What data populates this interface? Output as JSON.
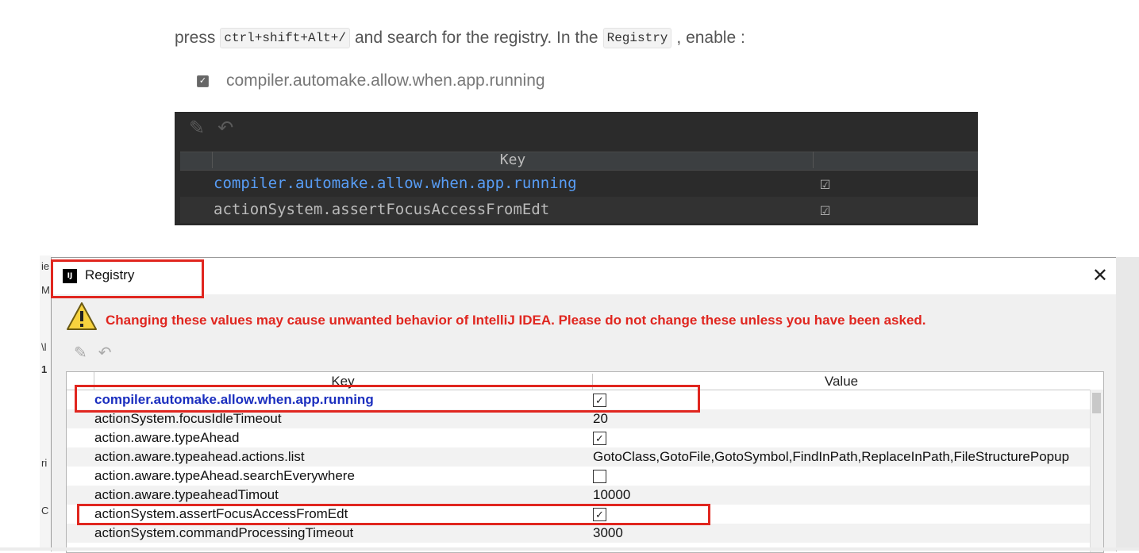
{
  "article": {
    "line1_pre": "press",
    "line1_code": "ctrl+shift+Alt+/",
    "line1_mid": "and search for the registry. In the",
    "line1_code2": "Registry",
    "line1_post": ", enable :",
    "checkbox_label": "compiler.automake.allow.when.app.running"
  },
  "dark_shot": {
    "header_key": "Key",
    "rows": [
      {
        "key": "compiler.automake.allow.when.app.running",
        "checked": true
      },
      {
        "key": "actionSystem.assertFocusAccessFromEdt",
        "checked": true
      }
    ]
  },
  "dialog": {
    "title": "Registry",
    "warning": "Changing these values may cause unwanted behavior of IntelliJ IDEA. Please do not change these unless you have been asked.",
    "columns": {
      "key": "Key",
      "value": "Value"
    },
    "rows": [
      {
        "key": "compiler.automake.allow.when.app.running",
        "value": "☑"
      },
      {
        "key": "actionSystem.focusIdleTimeout",
        "value": "20"
      },
      {
        "key": "action.aware.typeAhead",
        "value": "☑"
      },
      {
        "key": "action.aware.typeahead.actions.list",
        "value": "GotoClass,GotoFile,GotoSymbol,FindInPath,ReplaceInPath,FileStructurePopup"
      },
      {
        "key": "action.aware.typeAhead.searchEverywhere",
        "value": "☐"
      },
      {
        "key": "action.aware.typeaheadTimout",
        "value": "10000"
      },
      {
        "key": "actionSystem.assertFocusAccessFromEdt",
        "value": "☑"
      },
      {
        "key": "actionSystem.commandProcessingTimeout",
        "value": "3000"
      }
    ]
  },
  "left_strip": {
    "chars": [
      "ie",
      "M",
      "\\l",
      "1",
      "ri",
      "C",
      "Σ"
    ]
  },
  "colors": {
    "highlight_red": "#e0261f",
    "selected_key": "#1b2fbf",
    "dark_bg": "#2b2b2b",
    "dark_link": "#589df6"
  },
  "icons": [
    "edit-icon",
    "revert-icon",
    "warning-icon",
    "intellij-icon",
    "close-icon",
    "checkbox-icon"
  ]
}
